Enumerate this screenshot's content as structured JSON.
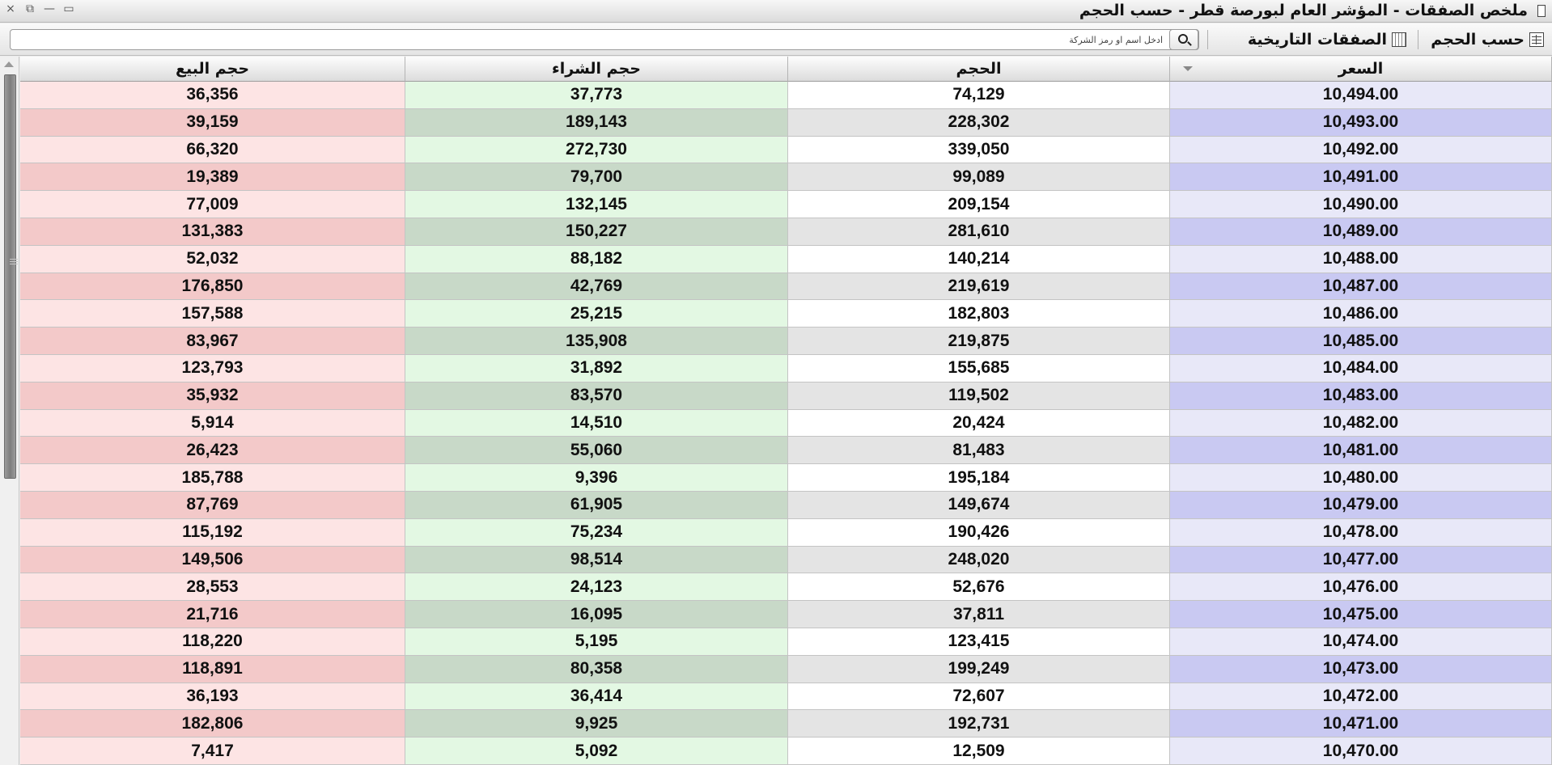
{
  "window": {
    "title": "ملخص الصفقات - المؤشر العام لبورصة قطر - حسب الحجم",
    "controls": [
      "×",
      "⧉",
      "—",
      "▭"
    ]
  },
  "toolbar": {
    "by_volume_label": "حسب الحجم",
    "historical_label": "الصفقات التاريخية",
    "search_placeholder": "ادخل اسم او رمز الشركة"
  },
  "table": {
    "columns": [
      "السعر",
      "الحجم",
      "حجم الشراء",
      "حجم البيع"
    ],
    "colors": {
      "price_even": "#e8e8f8",
      "price_odd": "#c9c9f2",
      "vol_even": "#ffffff",
      "vol_odd": "#e4e4e4",
      "buy_even": "#e3f8e3",
      "buy_odd": "#c8d9c8",
      "sell_even": "#fde4e4",
      "sell_odd": "#f3c9c9"
    },
    "rows": [
      [
        "10,494.00",
        "74,129",
        "37,773",
        "36,356"
      ],
      [
        "10,493.00",
        "228,302",
        "189,143",
        "39,159"
      ],
      [
        "10,492.00",
        "339,050",
        "272,730",
        "66,320"
      ],
      [
        "10,491.00",
        "99,089",
        "79,700",
        "19,389"
      ],
      [
        "10,490.00",
        "209,154",
        "132,145",
        "77,009"
      ],
      [
        "10,489.00",
        "281,610",
        "150,227",
        "131,383"
      ],
      [
        "10,488.00",
        "140,214",
        "88,182",
        "52,032"
      ],
      [
        "10,487.00",
        "219,619",
        "42,769",
        "176,850"
      ],
      [
        "10,486.00",
        "182,803",
        "25,215",
        "157,588"
      ],
      [
        "10,485.00",
        "219,875",
        "135,908",
        "83,967"
      ],
      [
        "10,484.00",
        "155,685",
        "31,892",
        "123,793"
      ],
      [
        "10,483.00",
        "119,502",
        "83,570",
        "35,932"
      ],
      [
        "10,482.00",
        "20,424",
        "14,510",
        "5,914"
      ],
      [
        "10,481.00",
        "81,483",
        "55,060",
        "26,423"
      ],
      [
        "10,480.00",
        "195,184",
        "9,396",
        "185,788"
      ],
      [
        "10,479.00",
        "149,674",
        "61,905",
        "87,769"
      ],
      [
        "10,478.00",
        "190,426",
        "75,234",
        "115,192"
      ],
      [
        "10,477.00",
        "248,020",
        "98,514",
        "149,506"
      ],
      [
        "10,476.00",
        "52,676",
        "24,123",
        "28,553"
      ],
      [
        "10,475.00",
        "37,811",
        "16,095",
        "21,716"
      ],
      [
        "10,474.00",
        "123,415",
        "5,195",
        "118,220"
      ],
      [
        "10,473.00",
        "199,249",
        "80,358",
        "118,891"
      ],
      [
        "10,472.00",
        "72,607",
        "36,414",
        "36,193"
      ],
      [
        "10,471.00",
        "192,731",
        "9,925",
        "182,806"
      ],
      [
        "10,470.00",
        "12,509",
        "5,092",
        "7,417"
      ]
    ]
  }
}
